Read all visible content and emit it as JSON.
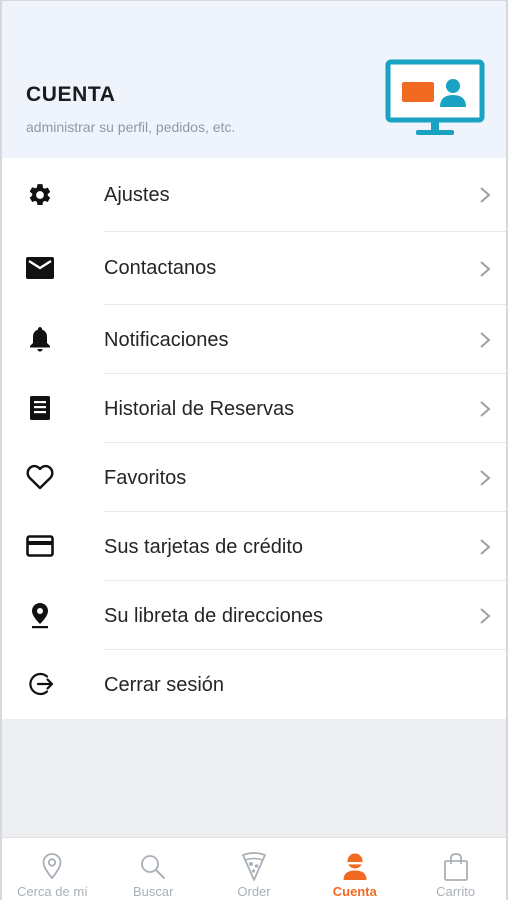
{
  "header": {
    "title": "CUENTA",
    "subtitle": "administrar su perfil, pedidos, etc.",
    "illustration": "profile-monitor-icon"
  },
  "menu": [
    {
      "label": "Ajustes",
      "icon": "gear-icon",
      "chevron": true
    },
    {
      "label": "Contactanos",
      "icon": "envelope-icon",
      "chevron": true
    },
    {
      "label": "Notificaciones",
      "icon": "bell-icon",
      "chevron": true
    },
    {
      "label": "Historial de Reservas",
      "icon": "receipt-icon",
      "chevron": true
    },
    {
      "label": "Favoritos",
      "icon": "heart-icon",
      "chevron": true
    },
    {
      "label": "Sus tarjetas de crédito",
      "icon": "credit-card-icon",
      "chevron": true
    },
    {
      "label": "Su libreta de direcciones",
      "icon": "location-pin-icon",
      "chevron": true
    },
    {
      "label": "Cerrar sesión",
      "icon": "logout-icon",
      "chevron": false
    }
  ],
  "tabbar": {
    "tabs": [
      {
        "label": "Cerca de mí",
        "icon": "map-pin-icon",
        "active": false
      },
      {
        "label": "Buscar",
        "icon": "search-icon",
        "active": false
      },
      {
        "label": "Order",
        "icon": "pizza-icon",
        "active": false
      },
      {
        "label": "Cuenta",
        "icon": "user-icon",
        "active": true
      },
      {
        "label": "Carrito",
        "icon": "shopping-bag-icon",
        "active": false
      }
    ]
  },
  "colors": {
    "accent": "#f26a22",
    "teal": "#1aa2c2",
    "header_bg": "#eef3fc",
    "inactive_tab": "#a9b0b7"
  }
}
